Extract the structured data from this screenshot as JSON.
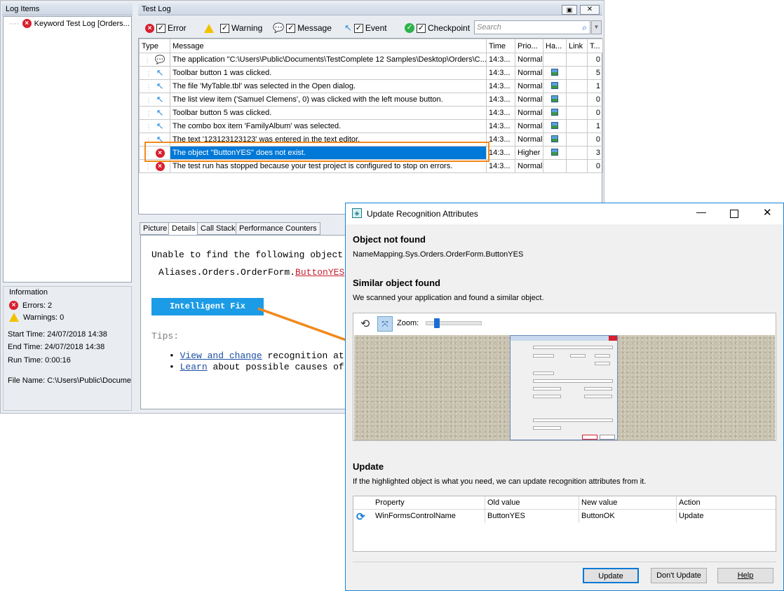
{
  "log_items": {
    "title": "Log Items",
    "item": "Keyword Test Log [Orders..."
  },
  "information": {
    "title": "Information",
    "errors": "Errors: 2",
    "warnings": "Warnings: 0",
    "start_time": "Start Time: 24/07/2018 14:38",
    "end_time": "End Time: 24/07/2018 14:38",
    "run_time": "Run Time: 0:00:16",
    "file_name": "File Name: C:\\Users\\Public\\Documer"
  },
  "test_log": {
    "title": "Test Log",
    "filters": {
      "error": "Error",
      "warning": "Warning",
      "message": "Message",
      "event": "Event",
      "checkpoint": "Checkpoint"
    },
    "search_placeholder": "Search",
    "columns": [
      "Type",
      "Message",
      "Time",
      "Prio...",
      "Ha...",
      "Link",
      "T..."
    ],
    "rows": [
      {
        "type": "message",
        "message": "The application \"C:\\Users\\Public\\Documents\\TestComplete 12 Samples\\Desktop\\Orders\\C...",
        "time": "14:3...",
        "priority": "Normal",
        "has_picture": false,
        "count": "0"
      },
      {
        "type": "event",
        "message": "Toolbar button 1 was clicked.",
        "time": "14:3...",
        "priority": "Normal",
        "has_picture": true,
        "count": "5"
      },
      {
        "type": "event",
        "message": "The file 'MyTable.tbl' was selected in the Open dialog.",
        "time": "14:3...",
        "priority": "Normal",
        "has_picture": true,
        "count": "1"
      },
      {
        "type": "event",
        "message": "The list view item ('Samuel Clemens', 0) was clicked with the left mouse button.",
        "time": "14:3...",
        "priority": "Normal",
        "has_picture": true,
        "count": "0"
      },
      {
        "type": "event",
        "message": "Toolbar button 5 was clicked.",
        "time": "14:3...",
        "priority": "Normal",
        "has_picture": true,
        "count": "0"
      },
      {
        "type": "event",
        "message": "The combo box item 'FamilyAlbum' was selected.",
        "time": "14:3...",
        "priority": "Normal",
        "has_picture": true,
        "count": "1"
      },
      {
        "type": "event",
        "message": "The text '123123123123' was entered in the text editor.",
        "time": "14:3...",
        "priority": "Normal",
        "has_picture": true,
        "count": "0"
      },
      {
        "type": "error",
        "message": "The object \"ButtonYES\" does not exist.",
        "time": "14:3...",
        "priority": "Higher",
        "has_picture": true,
        "count": "3",
        "selected": true
      },
      {
        "type": "error",
        "message": "The test run has stopped because your test project is configured to stop on errors.",
        "time": "14:3...",
        "priority": "Normal",
        "has_picture": false,
        "count": "0"
      }
    ]
  },
  "bottom_tabs": [
    "Picture",
    "Details",
    "Call Stack",
    "Performance Counters"
  ],
  "details": {
    "line1": "Unable to find the following object",
    "alias_prefix": "Aliases.Orders.OrderForm.",
    "alias_object": "ButtonYES",
    "intelligent_fix": "Intelligent Fix",
    "tips": "Tips:",
    "tip1_link": "View and change",
    "tip1_text": " recognition at",
    "tip2_link": "Learn",
    "tip2_text": " about possible causes of"
  },
  "dialog": {
    "title": "Update Recognition Attributes",
    "not_found_heading": "Object not found",
    "not_found_path": "NameMapping.Sys.Orders.OrderForm.ButtonYES",
    "similar_heading": "Similar object found",
    "similar_text": "We scanned your application and found a similar object.",
    "zoom_label": "Zoom:",
    "zoom_level": 0.15,
    "update_heading": "Update",
    "update_text": "If the highlighted object is what you need, we can update recognition attributes from it.",
    "table_columns": [
      "Property",
      "Old value",
      "New value",
      "Action"
    ],
    "table_row": {
      "property": "WinFormsControlName",
      "old": "ButtonYES",
      "new": "ButtonOK",
      "action": "Update"
    },
    "buttons": {
      "update": "Update",
      "dont_update": "Don't Update",
      "help": "Help"
    }
  },
  "colors": {
    "selection": "#0078d7",
    "highlight": "#f08a1c",
    "accent": "#1c9be6",
    "error": "#d8202f"
  }
}
